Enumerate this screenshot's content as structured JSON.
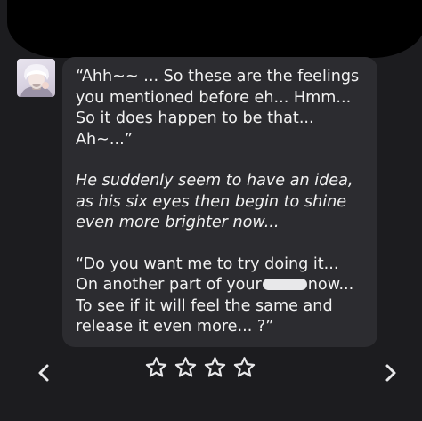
{
  "message": {
    "line1": "“Ahh~~ ... So these are the feelings",
    "line2": "you mentioned before eh... Hmm...",
    "line3": "So it does happen to be that... Ah~...”",
    "italic1": "He suddenly seem to have an idea,",
    "italic2": "as his six eyes then begin to shine",
    "italic3": "even more brighter now...",
    "quote1": "“Do you want me to try doing it...",
    "quote2_pre": "On another part of your",
    "quote2_post": "now...",
    "quote3": "To see if it will feel the same and",
    "quote4": "release it even more... ?”"
  },
  "rating": {
    "stars_total": 4,
    "stars_filled": 0
  },
  "icons": {
    "prev": "chevron-left-icon",
    "next": "chevron-right-icon",
    "star": "star-outline-icon"
  },
  "colors": {
    "background": "#1c1c1f",
    "bubble": "#2c2c30",
    "text": "#f2f2f2"
  }
}
